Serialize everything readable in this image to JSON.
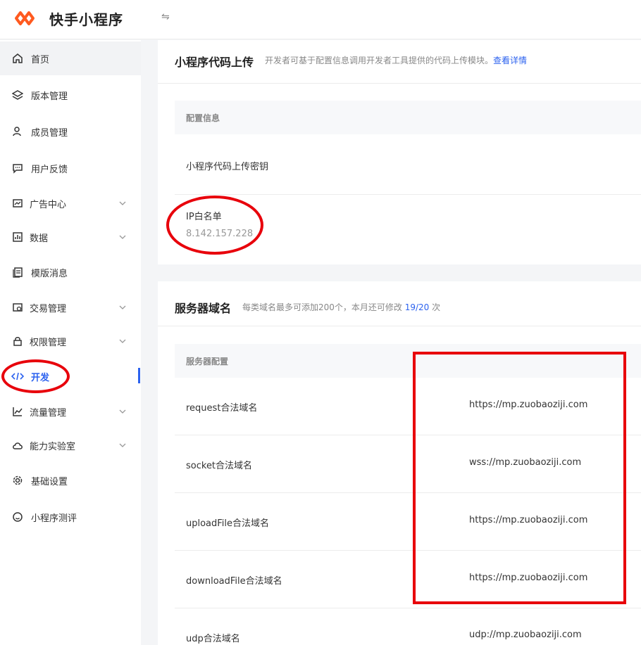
{
  "header": {
    "app_title": "快手小程序",
    "logo_icon": "kuaishou-logo-icon",
    "collapse_icon": "collapse-toggle-icon",
    "brand_color": "#ff5a1f"
  },
  "sidebar": {
    "items": [
      {
        "label": "首页",
        "icon": "home-icon"
      },
      {
        "label": "版本管理",
        "icon": "layers-icon"
      },
      {
        "label": "成员管理",
        "icon": "user-icon"
      },
      {
        "label": "用户反馈",
        "icon": "message-icon"
      },
      {
        "label": "广告中心",
        "icon": "ad-icon",
        "expandable": true
      },
      {
        "label": "数据",
        "icon": "chart-icon",
        "expandable": true
      },
      {
        "label": "模版消息",
        "icon": "template-icon"
      },
      {
        "label": "交易管理",
        "icon": "trade-icon",
        "expandable": true
      },
      {
        "label": "权限管理",
        "icon": "lock-icon",
        "expandable": true
      },
      {
        "label": "开发",
        "icon": "code-icon",
        "active": true
      },
      {
        "label": "流量管理",
        "icon": "trend-icon",
        "expandable": true
      },
      {
        "label": "能力实验室",
        "icon": "cloud-icon",
        "expandable": true
      },
      {
        "label": "基础设置",
        "icon": "gear-icon"
      },
      {
        "label": "小程序测评",
        "icon": "smile-icon"
      }
    ],
    "active_color": "#2c62ef"
  },
  "upload_section": {
    "title": "小程序代码上传",
    "description": "开发者可基于配置信息调用开发者工具提供的代码上传模块。",
    "link": "查看详情",
    "table_header": "配置信息",
    "key_label": "小程序代码上传密钥",
    "ip_label": "IP白名单",
    "ip_value": "8.142.157.228"
  },
  "server_section": {
    "title": "服务器域名",
    "description_prefix": "每类域名最多可添加200个，本月还可修改",
    "quota": "19/20",
    "description_suffix": "次",
    "table_header": "服务器配置",
    "rows": [
      {
        "label": "request合法域名",
        "value": "https://mp.zuobaoziji.com"
      },
      {
        "label": "socket合法域名",
        "value": "wss://mp.zuobaoziji.com"
      },
      {
        "label": "uploadFile合法域名",
        "value": "https://mp.zuobaoziji.com"
      },
      {
        "label": "downloadFile合法域名",
        "value": "https://mp.zuobaoziji.com"
      },
      {
        "label": "udp合法域名",
        "value": "udp://mp.zuobaoziji.com"
      }
    ]
  },
  "annotation_color": "#e8000b"
}
